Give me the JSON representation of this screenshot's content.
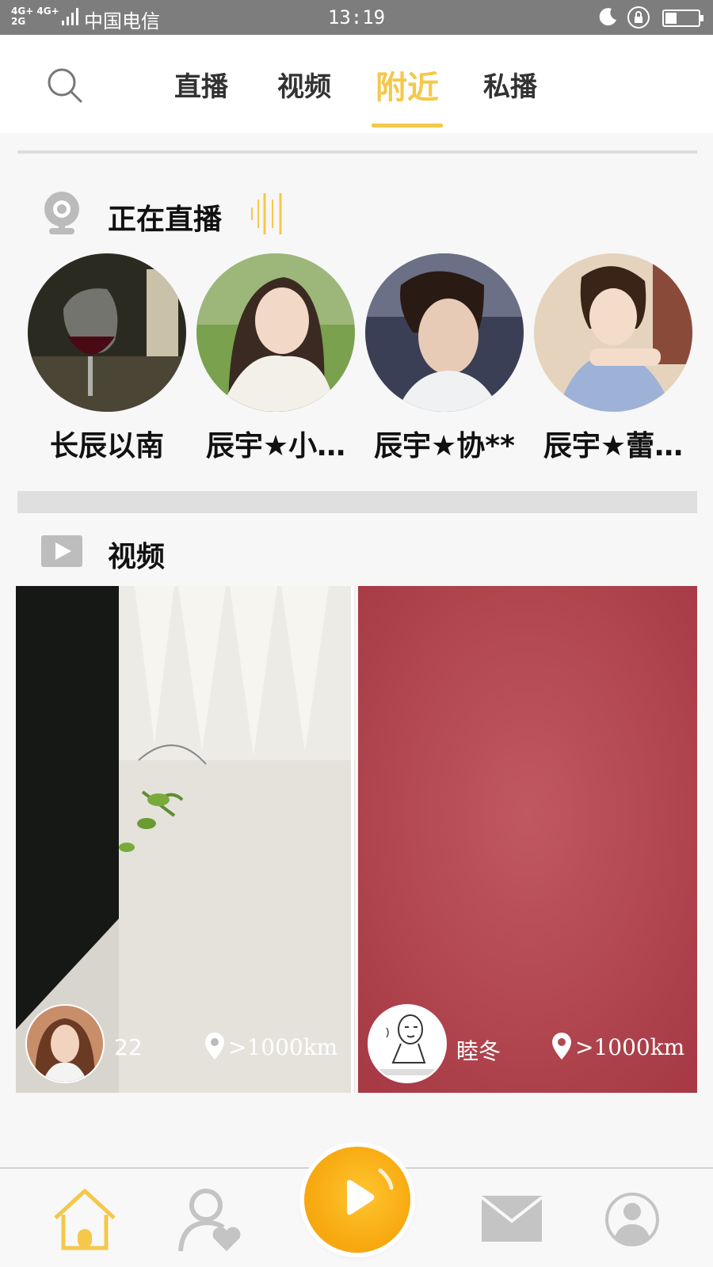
{
  "status_bar": {
    "network_top": "4G+ 4G+",
    "network_bottom": "2G",
    "carrier": "中国电信",
    "time": "13:19"
  },
  "nav": {
    "tabs": [
      {
        "label": "直播",
        "active": false
      },
      {
        "label": "视频",
        "active": false
      },
      {
        "label": "附近",
        "active": true
      },
      {
        "label": "私播",
        "active": false
      }
    ],
    "accent_color": "#f5c84a"
  },
  "live": {
    "title": "正在直播",
    "items": [
      {
        "name": "长辰以南"
      },
      {
        "name": "辰宇★小…"
      },
      {
        "name": "辰宇★协**"
      },
      {
        "name": "辰宇★蕾…"
      }
    ]
  },
  "videos": {
    "title": "视频",
    "items": [
      {
        "user": "22",
        "distance": ">1000km"
      },
      {
        "user": "睦冬",
        "distance": ">1000km"
      }
    ]
  },
  "bottom_bar": {
    "icons": [
      "home-icon",
      "friends-icon",
      "play-icon",
      "mail-icon",
      "profile-icon"
    ]
  }
}
